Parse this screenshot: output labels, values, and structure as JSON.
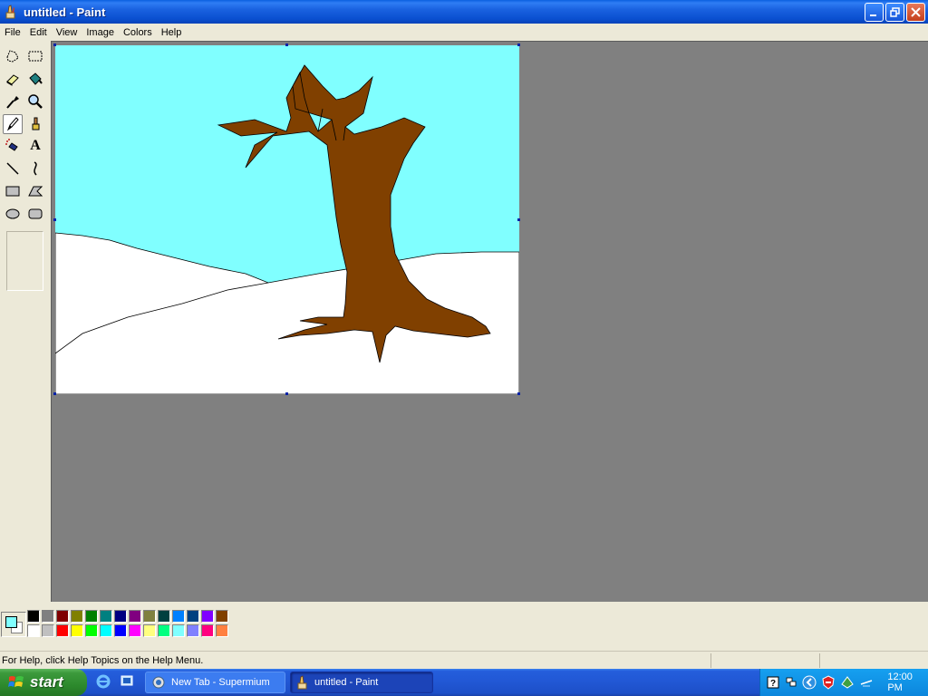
{
  "window": {
    "title": "untitled - Paint",
    "icon": "paint-brush-icon"
  },
  "menu": {
    "items": [
      "File",
      "Edit",
      "View",
      "Image",
      "Colors",
      "Help"
    ]
  },
  "toolbox": {
    "tools": [
      {
        "id": "free-form-select",
        "icon": "free-form-select-icon"
      },
      {
        "id": "select",
        "icon": "rect-select-icon"
      },
      {
        "id": "eraser",
        "icon": "eraser-icon"
      },
      {
        "id": "fill",
        "icon": "fill-bucket-icon"
      },
      {
        "id": "pick-color",
        "icon": "eyedropper-icon"
      },
      {
        "id": "magnifier",
        "icon": "magnifier-icon"
      },
      {
        "id": "pencil",
        "icon": "pencil-icon",
        "active": true
      },
      {
        "id": "brush",
        "icon": "brush-icon"
      },
      {
        "id": "airbrush",
        "icon": "airbrush-icon"
      },
      {
        "id": "text",
        "icon": "text-tool-icon",
        "glyph": "A"
      },
      {
        "id": "line",
        "icon": "line-tool-icon"
      },
      {
        "id": "curve",
        "icon": "curve-tool-icon"
      },
      {
        "id": "rectangle",
        "icon": "rectangle-tool-icon"
      },
      {
        "id": "polygon",
        "icon": "polygon-tool-icon"
      },
      {
        "id": "ellipse",
        "icon": "ellipse-tool-icon"
      },
      {
        "id": "rounded-rectangle",
        "icon": "rounded-rect-tool-icon"
      }
    ]
  },
  "canvas": {
    "sky_color": "#80ffff",
    "snow_color": "#ffffff",
    "trunk_color": "#804000"
  },
  "palette": {
    "foreground": "#80ffff",
    "background": "#ffffff",
    "row1": [
      "#000000",
      "#808080",
      "#800000",
      "#808000",
      "#008000",
      "#008080",
      "#000080",
      "#800080",
      "#808040",
      "#004040",
      "#0080ff",
      "#004080",
      "#8000ff",
      "#804000"
    ],
    "row2": [
      "#ffffff",
      "#c0c0c0",
      "#ff0000",
      "#ffff00",
      "#00ff00",
      "#00ffff",
      "#0000ff",
      "#ff00ff",
      "#ffff80",
      "#00ff80",
      "#80ffff",
      "#8080ff",
      "#ff0080",
      "#ff8040"
    ]
  },
  "status": {
    "text": "For Help, click Help Topics on the Help Menu."
  },
  "taskbar": {
    "start_label": "start",
    "tasks": [
      {
        "label": "New Tab - Supermium",
        "active": false
      },
      {
        "label": "untitled - Paint",
        "active": true
      }
    ],
    "clock": "12:00 PM"
  }
}
